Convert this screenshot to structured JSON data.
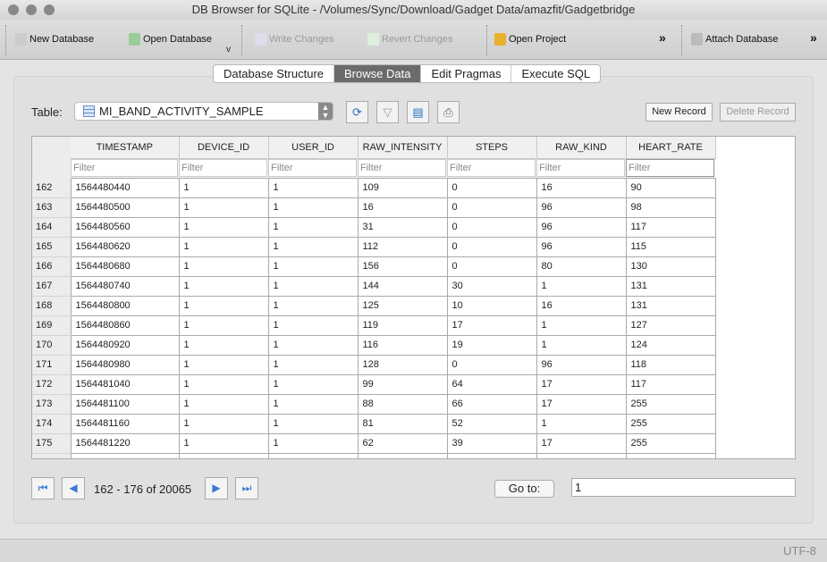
{
  "window": {
    "title": "DB Browser for SQLite - /Volumes/Sync/Download/Gadget Data/amazfit/Gadgetbridge"
  },
  "toolbar": {
    "new_database": "New Database",
    "open_database": "Open Database",
    "write_changes": "Write Changes",
    "revert_changes": "Revert Changes",
    "open_project": "Open Project",
    "attach_database": "Attach Database",
    "more": "»"
  },
  "tabs": [
    "Database Structure",
    "Browse Data",
    "Edit Pragmas",
    "Execute SQL"
  ],
  "browse": {
    "table_label": "Table:",
    "table_value": "MI_BAND_ACTIVITY_SAMPLE",
    "new_record": "New Record",
    "delete_record": "Delete Record",
    "filter_placeholder": "Filter"
  },
  "columns": [
    "TIMESTAMP",
    "DEVICE_ID",
    "USER_ID",
    "RAW_INTENSITY",
    "STEPS",
    "RAW_KIND",
    "HEART_RATE"
  ],
  "rows": [
    [
      "162",
      "1564480440",
      "1",
      "1",
      "109",
      "0",
      "16",
      "90"
    ],
    [
      "163",
      "1564480500",
      "1",
      "1",
      "16",
      "0",
      "96",
      "98"
    ],
    [
      "164",
      "1564480560",
      "1",
      "1",
      "31",
      "0",
      "96",
      "117"
    ],
    [
      "165",
      "1564480620",
      "1",
      "1",
      "112",
      "0",
      "96",
      "115"
    ],
    [
      "166",
      "1564480680",
      "1",
      "1",
      "156",
      "0",
      "80",
      "130"
    ],
    [
      "167",
      "1564480740",
      "1",
      "1",
      "144",
      "30",
      "1",
      "131"
    ],
    [
      "168",
      "1564480800",
      "1",
      "1",
      "125",
      "10",
      "16",
      "131"
    ],
    [
      "169",
      "1564480860",
      "1",
      "1",
      "119",
      "17",
      "1",
      "127"
    ],
    [
      "170",
      "1564480920",
      "1",
      "1",
      "116",
      "19",
      "1",
      "124"
    ],
    [
      "171",
      "1564480980",
      "1",
      "1",
      "128",
      "0",
      "96",
      "118"
    ],
    [
      "172",
      "1564481040",
      "1",
      "1",
      "99",
      "64",
      "17",
      "117"
    ],
    [
      "173",
      "1564481100",
      "1",
      "1",
      "88",
      "66",
      "17",
      "255"
    ],
    [
      "174",
      "1564481160",
      "1",
      "1",
      "81",
      "52",
      "1",
      "255"
    ],
    [
      "175",
      "1564481220",
      "1",
      "1",
      "62",
      "39",
      "17",
      "255"
    ]
  ],
  "pager": {
    "range": "162 - 176 of 20065",
    "goto_label": "Go to:",
    "goto_value": "1"
  },
  "status": {
    "encoding": "UTF-8"
  }
}
